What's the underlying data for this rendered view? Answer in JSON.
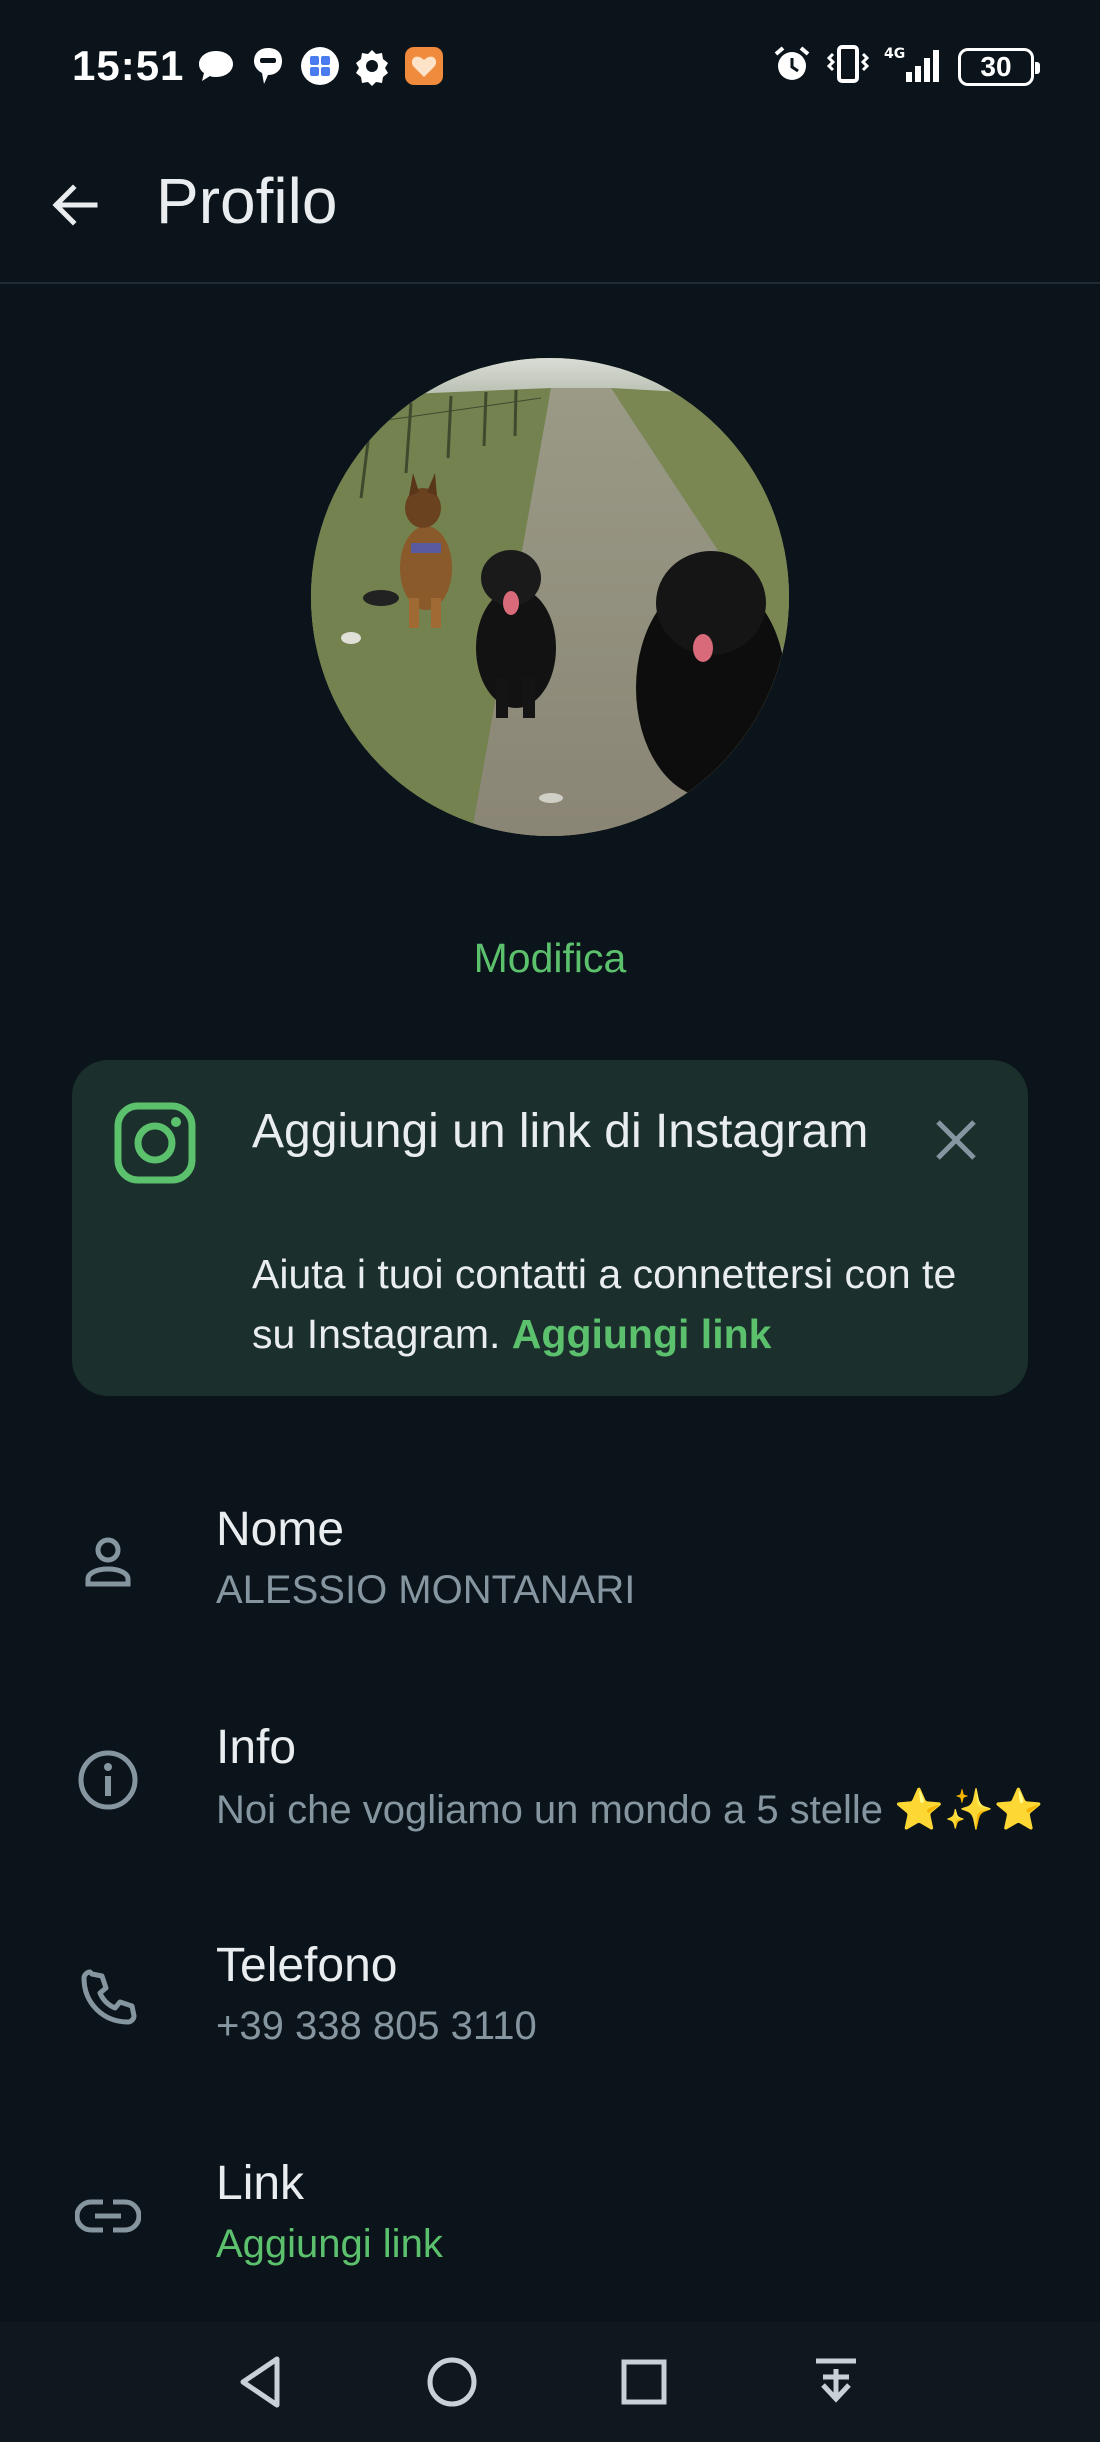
{
  "status_bar": {
    "time": "15:51",
    "battery": "30",
    "left_icons": [
      "chat-bubble-icon",
      "messenger-icon",
      "app-grid-icon",
      "gear-icon",
      "heart-app-icon"
    ],
    "right_icons": [
      "alarm-icon",
      "vibrate-icon",
      "signal-4g-icon",
      "battery-icon"
    ]
  },
  "header": {
    "title": "Profilo"
  },
  "profile": {
    "edit_label": "Modifica"
  },
  "instagram_card": {
    "title": "Aggiungi un link di Instagram",
    "description": "Aiuta i tuoi contatti a connettersi con te su Instagram.",
    "add_link": "Aggiungi link"
  },
  "fields": {
    "name": {
      "label": "Nome",
      "value": "ALESSIO MONTANARI"
    },
    "about": {
      "label": "Info",
      "value": "Noi che vogliamo un mondo a 5 stelle",
      "emoji": "⭐✨⭐"
    },
    "phone": {
      "label": "Telefono",
      "value": "+39 338 805 3110"
    },
    "link": {
      "label": "Link",
      "value": "Aggiungi link"
    }
  },
  "colors": {
    "background": "#0b141a",
    "accent": "#5cc16d",
    "card": "#1b2f2c",
    "secondary_text": "#8696a0"
  }
}
